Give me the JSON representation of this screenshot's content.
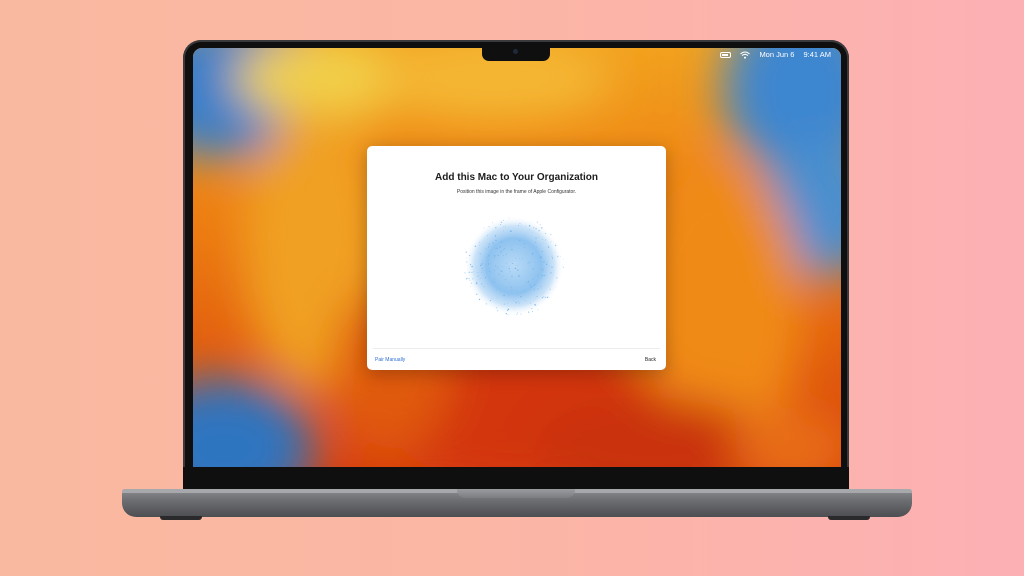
{
  "menubar": {
    "date": "Mon Jun 6",
    "time": "9:41 AM",
    "icons": [
      "battery-icon",
      "wifi-icon"
    ]
  },
  "dialog": {
    "title": "Add this Mac to Your Organization",
    "subtitle": "Position this image in the frame of Apple Configurator.",
    "pattern_icon": "pairing-particle-cloud",
    "pair_manually_label": "Pair Manually",
    "back_label": "Back"
  },
  "colors": {
    "background_left": "#f9b9a0",
    "background_right": "#fdb0b4",
    "wallpaper_orange": "#e96a16",
    "link_blue": "#2f6fd6",
    "pattern_blue": "#8ec2ef"
  }
}
